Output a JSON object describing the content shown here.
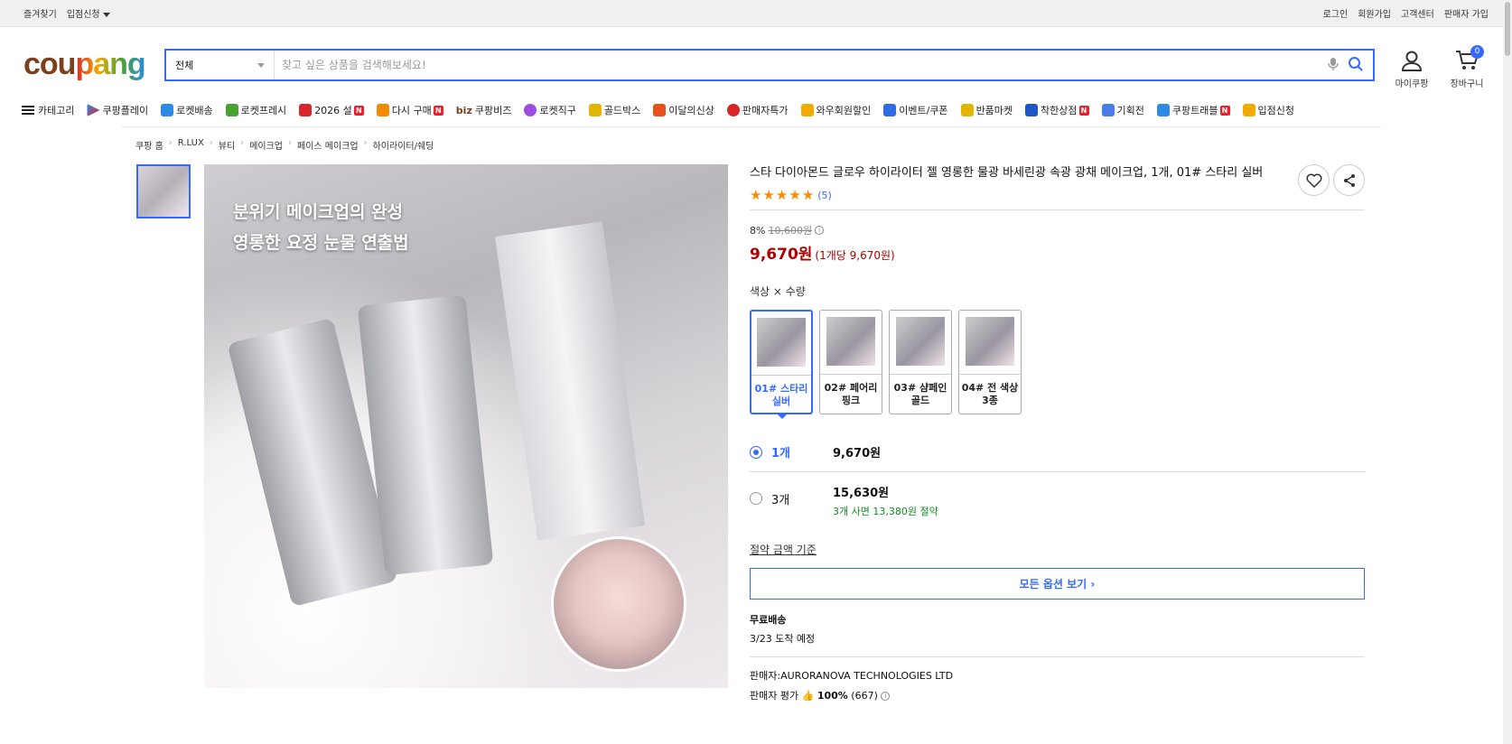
{
  "util": {
    "left": [
      "즐겨찾기",
      "입점신청"
    ],
    "right": [
      "로그인",
      "회원가입",
      "고객센터",
      "판매자 가입"
    ]
  },
  "logo": {
    "c": "cou",
    "p": "pang"
  },
  "search": {
    "category": "전체",
    "placeholder": "찾고 싶은 상품을 검색해보세요!"
  },
  "header": {
    "mycoupang": "마이쿠팡",
    "cart": "장바구니",
    "cart_count": "0"
  },
  "nav": {
    "category": "카테고리",
    "items": [
      "쿠팡플레이",
      "로켓배송",
      "로켓프레시",
      "2026 설",
      "다시 구매",
      "쿠팡비즈",
      "로켓직구",
      "골드박스",
      "이달의신상",
      "판매자특가",
      "와우회원할인",
      "이벤트/쿠폰",
      "반품마켓",
      "착한상점",
      "기획전",
      "쿠팡트래블",
      "입점신청"
    ],
    "biz_prefix": "biz"
  },
  "breadcrumb": [
    "쿠팡 홈",
    "R.LUX",
    "뷰티",
    "메이크업",
    "페이스 메이크업",
    "하이라이터/쉐딩"
  ],
  "image": {
    "line1": "분위기 메이크업의 완성",
    "line2": "영롱한 요정 눈물 연출법"
  },
  "product": {
    "title": "스타 다이아몬드 글로우 하이라이터 젤 영롱한 물광 바세린광 속광 광채 메이크업, 1개, 01# 스타리 실버",
    "review_count": "(5)",
    "discount": "8%",
    "original_price": "10,600원",
    "price": "9,670원",
    "unit_price": "(1개당 9,670원)"
  },
  "options": {
    "label": "색상 × 수량",
    "colors": [
      "01# 스타리 실버",
      "02# 페어리 핑크",
      "03# 샴페인 골드",
      "04# 전 색상 3종"
    ],
    "quantities": [
      {
        "label": "1개",
        "price": "9,670원",
        "save": ""
      },
      {
        "label": "3개",
        "price": "15,630원",
        "save": "3개 사면 13,380원 절약"
      }
    ],
    "save_basis": "절약 금액 기준",
    "all_button": "모든 옵션 보기 ›"
  },
  "shipping": {
    "title": "무료배송",
    "eta": "3/23 도착 예정"
  },
  "seller": {
    "name": "판매자:AURORANOVA TECHNOLOGIES LTD",
    "rating_label": "판매자 평가",
    "rating_value": "100%",
    "rating_count": "(667)"
  },
  "colors": {
    "accent": "#346aff",
    "price": "#ae0000",
    "save": "#128a25",
    "star": "#ff8a00"
  }
}
